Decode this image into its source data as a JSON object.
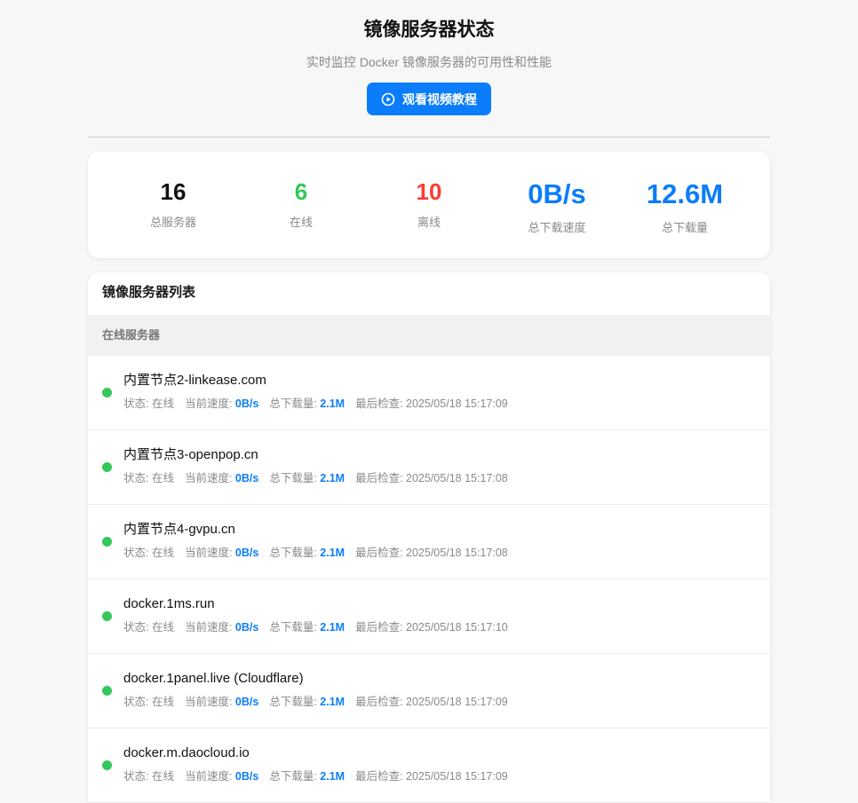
{
  "header": {
    "title": "镜像服务器状态",
    "subtitle": "实时监控 Docker 镜像服务器的可用性和性能",
    "tutorial_button": "观看视频教程"
  },
  "colors": {
    "accent": "#0b7dfa",
    "online": "#34c759",
    "offline": "#ff3b30"
  },
  "stats": [
    {
      "value": "16",
      "label": "总服务器",
      "color": "#111111",
      "big": false
    },
    {
      "value": "6",
      "label": "在线",
      "color": "#34c759",
      "big": false
    },
    {
      "value": "10",
      "label": "离线",
      "color": "#ff3b30",
      "big": false
    },
    {
      "value": "0B/s",
      "label": "总下载速度",
      "color": "#0b7dfa",
      "big": true
    },
    {
      "value": "12.6M",
      "label": "总下载量",
      "color": "#0b7dfa",
      "big": true
    }
  ],
  "list": {
    "title": "镜像服务器列表",
    "online_group_label": "在线服务器",
    "meta_labels": {
      "status": "状态: ",
      "speed": "当前速度: ",
      "total": "总下载量: ",
      "last_check": "最后检查: "
    },
    "servers": [
      {
        "name": "内置节点2-linkease.com",
        "status": "在线",
        "speed": "0B/s",
        "total": "2.1M",
        "last_check": "2025/05/18 15:17:09"
      },
      {
        "name": "内置节点3-openpop.cn",
        "status": "在线",
        "speed": "0B/s",
        "total": "2.1M",
        "last_check": "2025/05/18 15:17:08"
      },
      {
        "name": "内置节点4-gvpu.cn",
        "status": "在线",
        "speed": "0B/s",
        "total": "2.1M",
        "last_check": "2025/05/18 15:17:08"
      },
      {
        "name": "docker.1ms.run",
        "status": "在线",
        "speed": "0B/s",
        "total": "2.1M",
        "last_check": "2025/05/18 15:17:10"
      },
      {
        "name": "docker.1panel.live (Cloudflare)",
        "status": "在线",
        "speed": "0B/s",
        "total": "2.1M",
        "last_check": "2025/05/18 15:17:09"
      },
      {
        "name": "docker.m.daocloud.io",
        "status": "在线",
        "speed": "0B/s",
        "total": "2.1M",
        "last_check": "2025/05/18 15:17:09"
      }
    ]
  }
}
